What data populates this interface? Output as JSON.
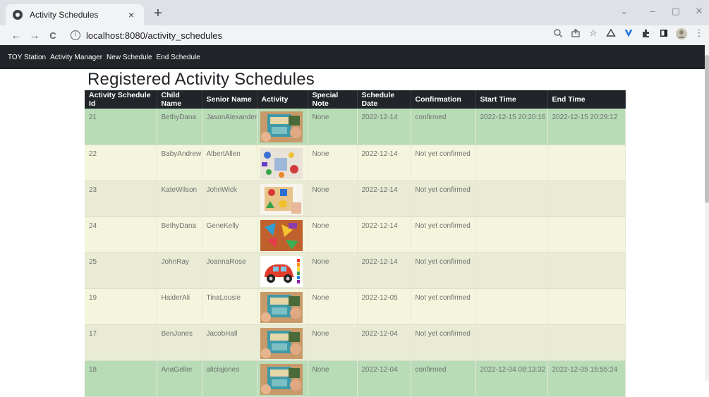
{
  "browser": {
    "tab_title": "Activity Schedules",
    "tab_close": "×",
    "new_tab": "+",
    "url": "localhost:8080/activity_schedules",
    "window_controls": [
      "⌄",
      "–",
      "▢",
      "✕"
    ],
    "nav": {
      "back": "←",
      "forward": "→",
      "reload": "C"
    },
    "toolbar_icons": [
      "zoom-icon",
      "share-icon",
      "bookmark-star-icon",
      "drive-icon",
      "vpn-icon",
      "extensions-icon",
      "sidepanel-icon",
      "profile-avatar"
    ]
  },
  "navbar": {
    "brand": "TOY Station",
    "links": [
      "Activity Manager",
      "New Schedule",
      "End Schedule"
    ]
  },
  "page": {
    "title": "Registered Activity Schedules"
  },
  "table": {
    "headers": [
      "Activity Schedule Id",
      "Child Name",
      "Senior Name",
      "Activity",
      "Special Note",
      "Schedule Date",
      "Confirmation",
      "Start Time",
      "End Time"
    ],
    "rows": [
      {
        "id": "21",
        "child": "BethyDana",
        "senior": "JasonAlexander",
        "activity_image": "book-activity",
        "note": "None",
        "date": "2022-12-14",
        "confirmation": "confirmed",
        "start": "2022-12-15 20:20:16",
        "end": "2022-12-15 20:29:12"
      },
      {
        "id": "22",
        "child": "BabyAndrew",
        "senior": "AlbertAllen",
        "activity_image": "blocks-activity",
        "note": "None",
        "date": "2022-12-14",
        "confirmation": "Not yet confirmed",
        "start": "",
        "end": ""
      },
      {
        "id": "23",
        "child": "KateWilson",
        "senior": "JohnWick",
        "activity_image": "shape-puzzle-activity",
        "note": "None",
        "date": "2022-12-14",
        "confirmation": "Not yet confirmed",
        "start": "",
        "end": ""
      },
      {
        "id": "24",
        "child": "BethyDana",
        "senior": "GeneKelly",
        "activity_image": "paper-shapes-activity",
        "note": "None",
        "date": "2022-12-14",
        "confirmation": "Not yet confirmed",
        "start": "",
        "end": ""
      },
      {
        "id": "25",
        "child": "JohnRay",
        "senior": "JoannaRose",
        "activity_image": "car-coloring-activity",
        "note": "None",
        "date": "2022-12-14",
        "confirmation": "Not yet confirmed",
        "start": "",
        "end": ""
      },
      {
        "id": "19",
        "child": "HaiderAli",
        "senior": "TinaLousie",
        "activity_image": "book-activity",
        "note": "None",
        "date": "2022-12-05",
        "confirmation": "Not yet confirmed",
        "start": "",
        "end": ""
      },
      {
        "id": "17",
        "child": "BenJones",
        "senior": "JacobHall",
        "activity_image": "book-activity",
        "note": "None",
        "date": "2022-12-04",
        "confirmation": "Not yet confirmed",
        "start": "",
        "end": ""
      },
      {
        "id": "18",
        "child": "AnaGeller",
        "senior": "aliciajones",
        "activity_image": "book-activity",
        "note": "None",
        "date": "2022-12-04",
        "confirmation": "confirmed",
        "start": "2022-12-04 08:13:32",
        "end": "2022-12-05 15:55:24"
      }
    ]
  },
  "colors": {
    "confirmed_row": "#b7dcb6",
    "pending_row_a": "#f4f5dc",
    "pending_row_b": "#e9ebd4",
    "navbar_bg": "#212529",
    "header_bg": "#212529"
  }
}
